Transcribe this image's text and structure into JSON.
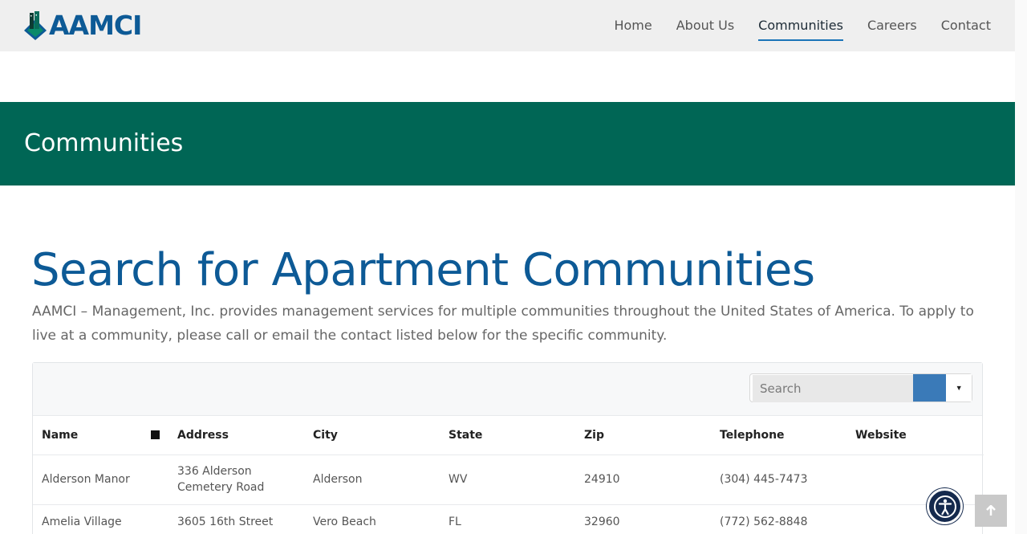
{
  "header": {
    "logo_text": "AAMCI",
    "nav": [
      {
        "label": "Home"
      },
      {
        "label": "About Us"
      },
      {
        "label": "Communities"
      },
      {
        "label": "Careers"
      },
      {
        "label": "Contact"
      }
    ],
    "active_nav": "Communities"
  },
  "banner": {
    "title": "Communities"
  },
  "main": {
    "title": "Search for Apartment Communities",
    "intro": "AAMCI – Management, Inc. provides management services for multiple communities throughout the United States of America. To apply to live at a community, please call or email the contact listed below for the specific community."
  },
  "table": {
    "search_placeholder": "Search",
    "columns": [
      "Name",
      "Address",
      "City",
      "State",
      "Zip",
      "Telephone",
      "Website"
    ],
    "rows": [
      {
        "name": "Alderson Manor",
        "address": "336 Alderson Cemetery Road",
        "city": "Alderson",
        "state": "WV",
        "zip": "24910",
        "telephone": "(304) 445-7473",
        "website": ""
      },
      {
        "name": "Amelia Village",
        "address": "3605 16th Street",
        "city": "Vero Beach",
        "state": "FL",
        "zip": "32960",
        "telephone": "(772) 562-8848",
        "website": ""
      }
    ]
  },
  "colors": {
    "brand_blue": "#0d5a96",
    "banner_green": "#006655",
    "search_button": "#3a7ab8"
  },
  "icons": {
    "accessibility": "accessibility-icon",
    "back_to_top": "arrow-up-icon",
    "dropdown": "caret-down-icon",
    "sort": "sort-icon"
  }
}
